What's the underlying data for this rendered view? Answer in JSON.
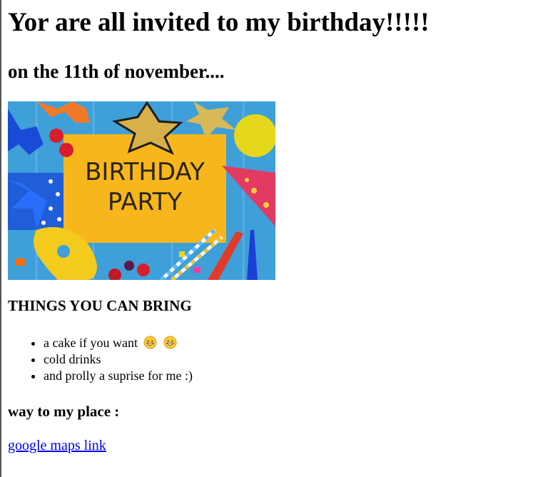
{
  "page": {
    "heading": "Yor are all invited to my birthday!!!!!",
    "subheading": "on the 11th of november....",
    "banner": {
      "card_line1": "BIRTHDAY",
      "card_line2": "PARTY"
    },
    "things_heading": "THINGS YOU CAN BRING",
    "things": [
      {
        "text": "a cake if you want",
        "emoji_count": 2,
        "emoji": "grinning-face"
      },
      {
        "text": "cold drinks"
      },
      {
        "text": "and prolly a suprise for me :)"
      }
    ],
    "way_heading": "way to my place :",
    "maps_link": "google maps link",
    "colors": {
      "link": "#0000ee",
      "card": "#f7b71c",
      "background_wood": "#3f9fd8"
    }
  }
}
